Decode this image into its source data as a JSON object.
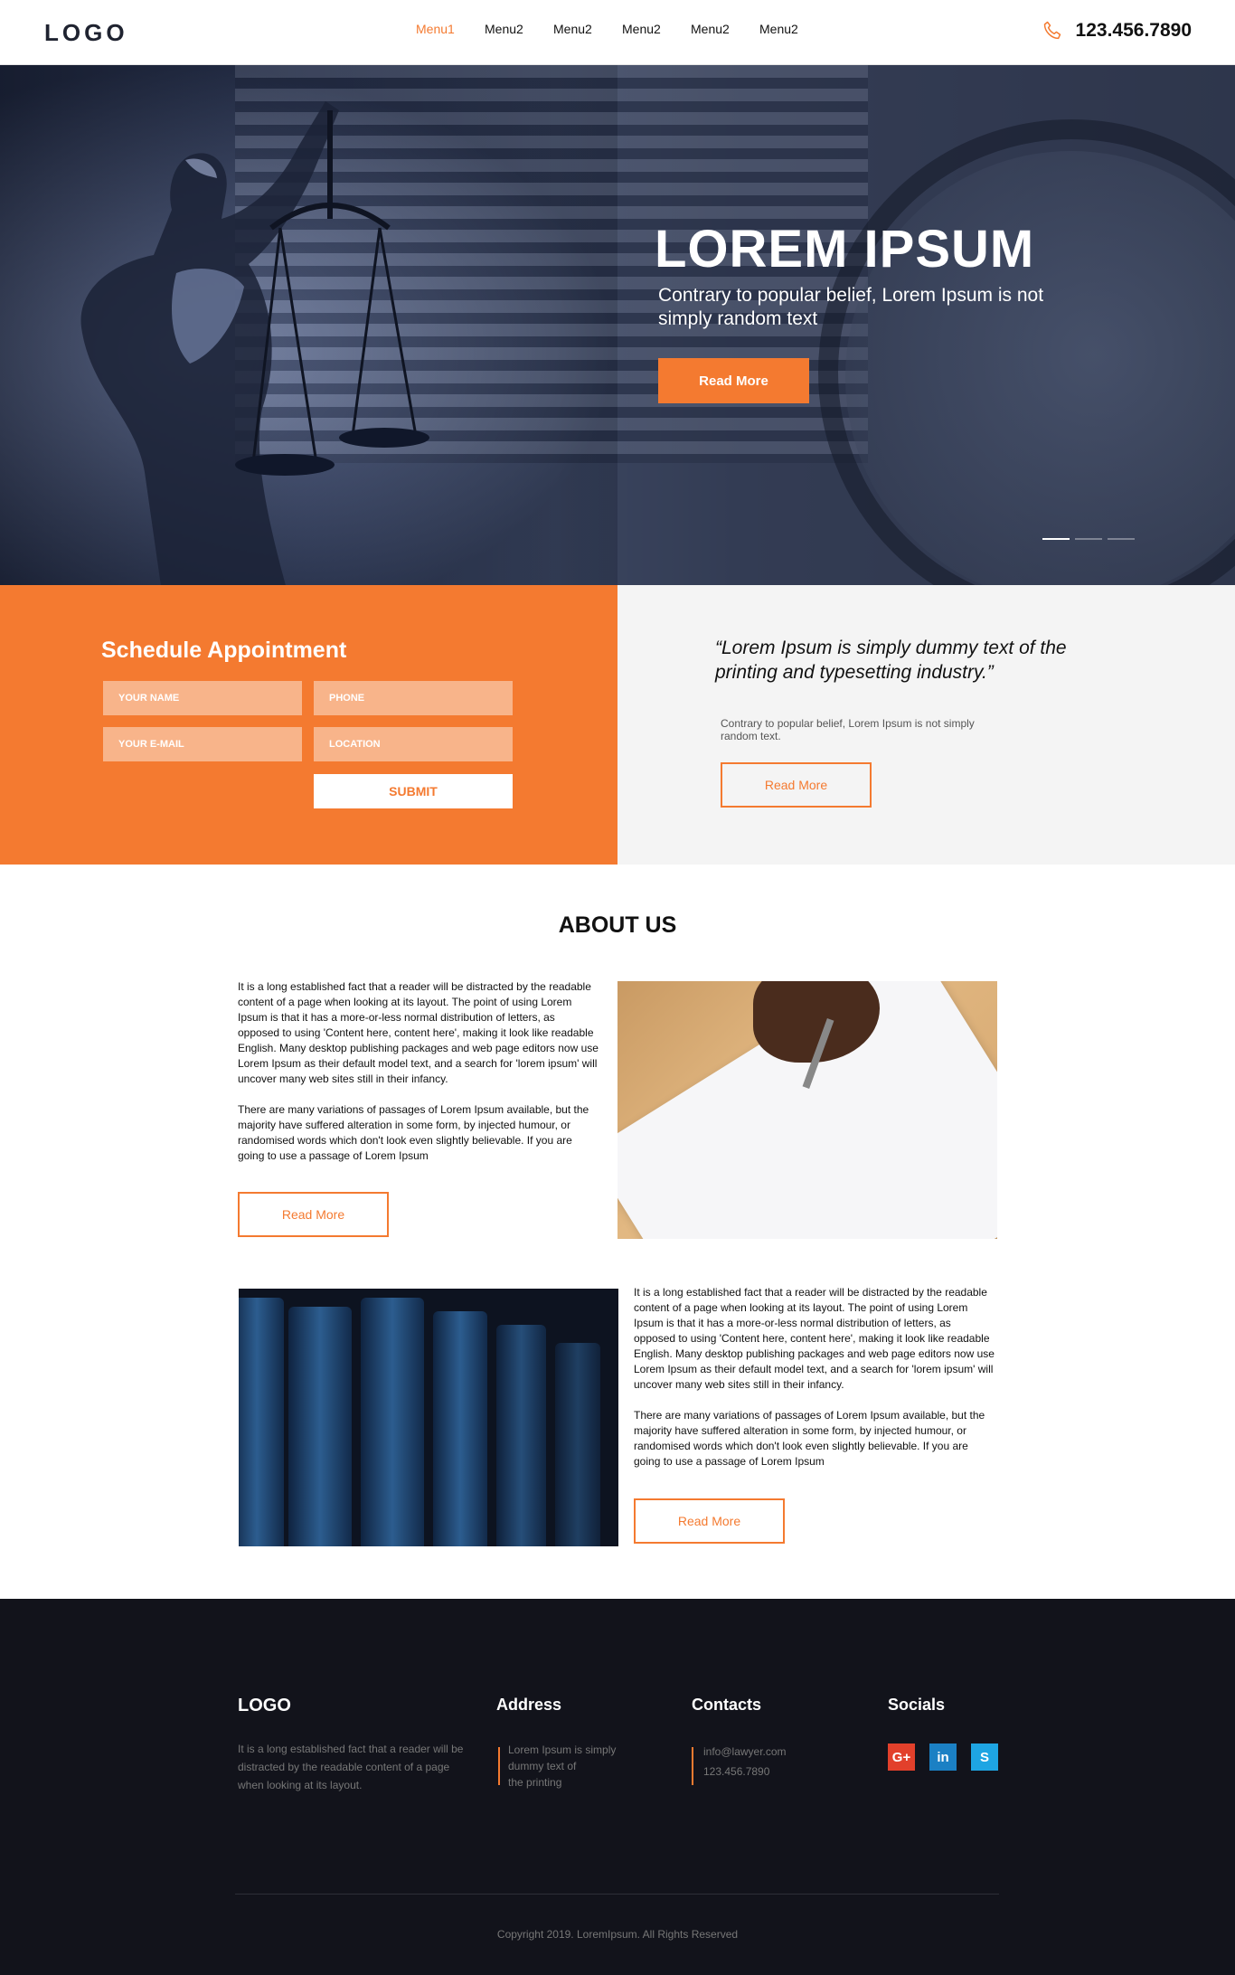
{
  "header": {
    "logo": "LOGO",
    "nav": [
      "Menu1",
      "Menu2",
      "Menu2",
      "Menu2",
      "Menu2",
      "Menu2"
    ],
    "phone": "123.456.7890",
    "accent": "#f47a30"
  },
  "hero": {
    "title": "LOREM IPSUM",
    "subtitle": "Contrary to popular belief, Lorem Ipsum is not simply random text",
    "button": "Read More",
    "slides": 3,
    "active_slide": 1
  },
  "appointment": {
    "title": "Schedule Appointment",
    "name_placeholder": "YOUR NAME",
    "phone_placeholder": "PHONE",
    "email_placeholder": "YOUR E-MAIL",
    "location_placeholder": "LOCATION",
    "submit": "SUBMIT"
  },
  "quote": {
    "text": "“Lorem Ipsum is simply dummy text of the printing and typesetting industry.”",
    "sub": "Contrary to popular belief, Lorem Ipsum is not simply random text.",
    "button": "Read More"
  },
  "about": {
    "title": "ABOUT US",
    "block1": {
      "p1": "It is a long established fact that a reader will be distracted by the readable content of a page when looking at its layout. The point of using Lorem Ipsum is that it has a more-or-less normal distribution of letters, as opposed to using 'Content here, content here', making it look like readable English. Many desktop publishing packages and web page editors now use Lorem Ipsum as their default model text, and a search for 'lorem ipsum' will uncover many web sites still in their infancy.",
      "p2": "There are many variations of passages of Lorem Ipsum available, but the majority have suffered alteration in some form, by injected humour, or randomised words which don't look even slightly believable. If you are going to use a passage of Lorem Ipsum",
      "button": "Read More"
    },
    "block2": {
      "p1": "It is a long established fact that a reader will be distracted by the readable content of a page when looking at its layout. The point of using Lorem Ipsum is that it has a more-or-less normal distribution of letters, as opposed to using 'Content here, content here', making it look like readable English. Many desktop publishing packages and web page editors now use Lorem Ipsum as their default model text, and a search for 'lorem ipsum' will uncover many web sites still in their infancy.",
      "p2": "There are many variations of passages of Lorem Ipsum available, but the majority have suffered alteration in some form, by injected humour, or randomised words which don't look even slightly believable. If you are going to use a passage of Lorem Ipsum",
      "button": "Read More"
    }
  },
  "footer": {
    "logo": "LOGO",
    "about_text": "It is a long established fact that a reader will be distracted by the readable content of a page when looking at its layout.",
    "address_title": "Address",
    "address": [
      "Lorem Ipsum is simply",
      "dummy text of",
      "the printing"
    ],
    "contacts_title": "Contacts",
    "email": "info@lawyer.com",
    "phone": "123.456.7890",
    "socials_title": "Socials",
    "socials": [
      "google-plus-icon",
      "linkedin-icon",
      "skype-icon"
    ],
    "copyright": "Copyright 2019. LoremIpsum. All Rights Reserved"
  }
}
